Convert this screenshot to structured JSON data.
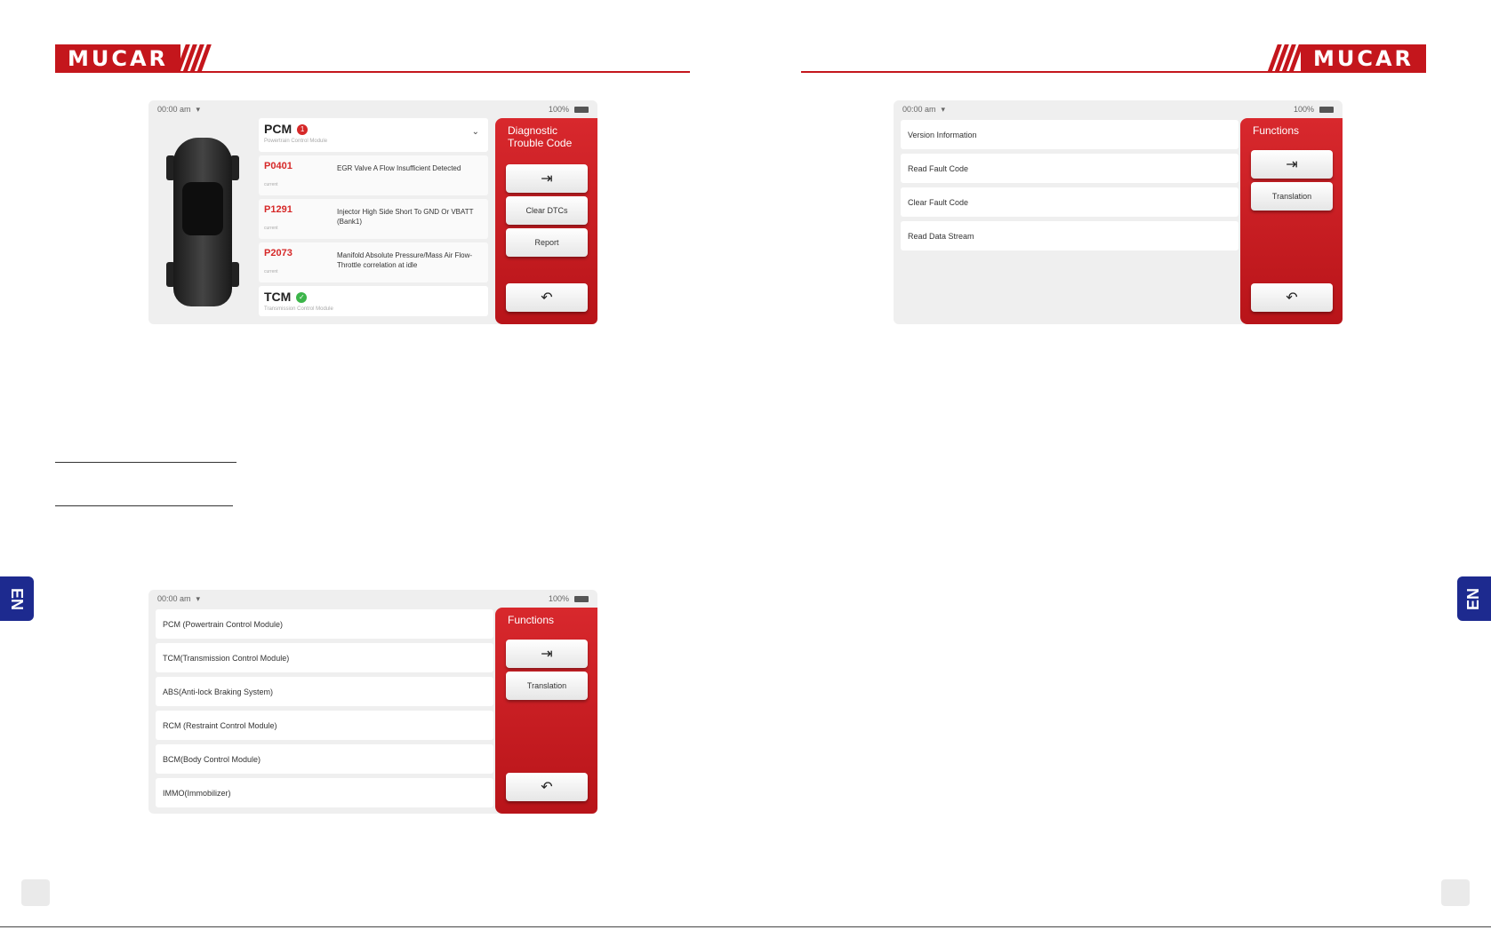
{
  "brand": {
    "logo_text": "MUCAR"
  },
  "left_page": {
    "dtc_screen": {
      "status": {
        "time": "00:00 am",
        "battery": "100%"
      },
      "modules": [
        {
          "name": "PCM",
          "badge": "1",
          "description": "Powertrain Control Module",
          "dtcs": [
            {
              "code": "P0401",
              "state": "current",
              "description": "EGR Valve A Flow Insufficient Detected"
            },
            {
              "code": "P1291",
              "state": "current",
              "description": "Injector High Side Short To GND Or VBATT (Bank1)"
            },
            {
              "code": "P2073",
              "state": "current",
              "description": "Manifold Absolute Pressure/Mass Air Flow-Throttle correlation at idle"
            }
          ]
        },
        {
          "name": "TCM",
          "badge": "✓",
          "description": "Transmission Control Module"
        }
      ],
      "panel": {
        "title_line1": "Diagnostic",
        "title_line2": "Trouble Code",
        "buttons": {
          "exit_icon": "exit-icon",
          "clear_dtcs": "Clear DTCs",
          "report": "Report",
          "back_icon": "back-icon"
        }
      }
    },
    "system_screen": {
      "status": {
        "time": "00:00 am",
        "battery": "100%"
      },
      "items": [
        "PCM (Powertrain Control Module)",
        "TCM(Transmission Control Module)",
        "ABS(Anti-lock Braking System)",
        "RCM (Restraint Control Module)",
        "BCM(Body Control Module)",
        "IMMO(Immobilizer)"
      ],
      "panel": {
        "title": "Functions",
        "translation": "Translation"
      }
    },
    "tab_label": "EN"
  },
  "right_page": {
    "function_screen": {
      "status": {
        "time": "00:00 am",
        "battery": "100%"
      },
      "items": [
        "Version Information",
        "Read Fault Code",
        "Clear Fault Code",
        "Read Data Stream"
      ],
      "panel": {
        "title": "Functions",
        "translation": "Translation"
      }
    },
    "tab_label": "EN"
  },
  "colors": {
    "brand_red": "#c4161c",
    "tab_blue": "#1d2a8f",
    "dtc_red": "#d62828",
    "ok_green": "#3cb54a"
  }
}
